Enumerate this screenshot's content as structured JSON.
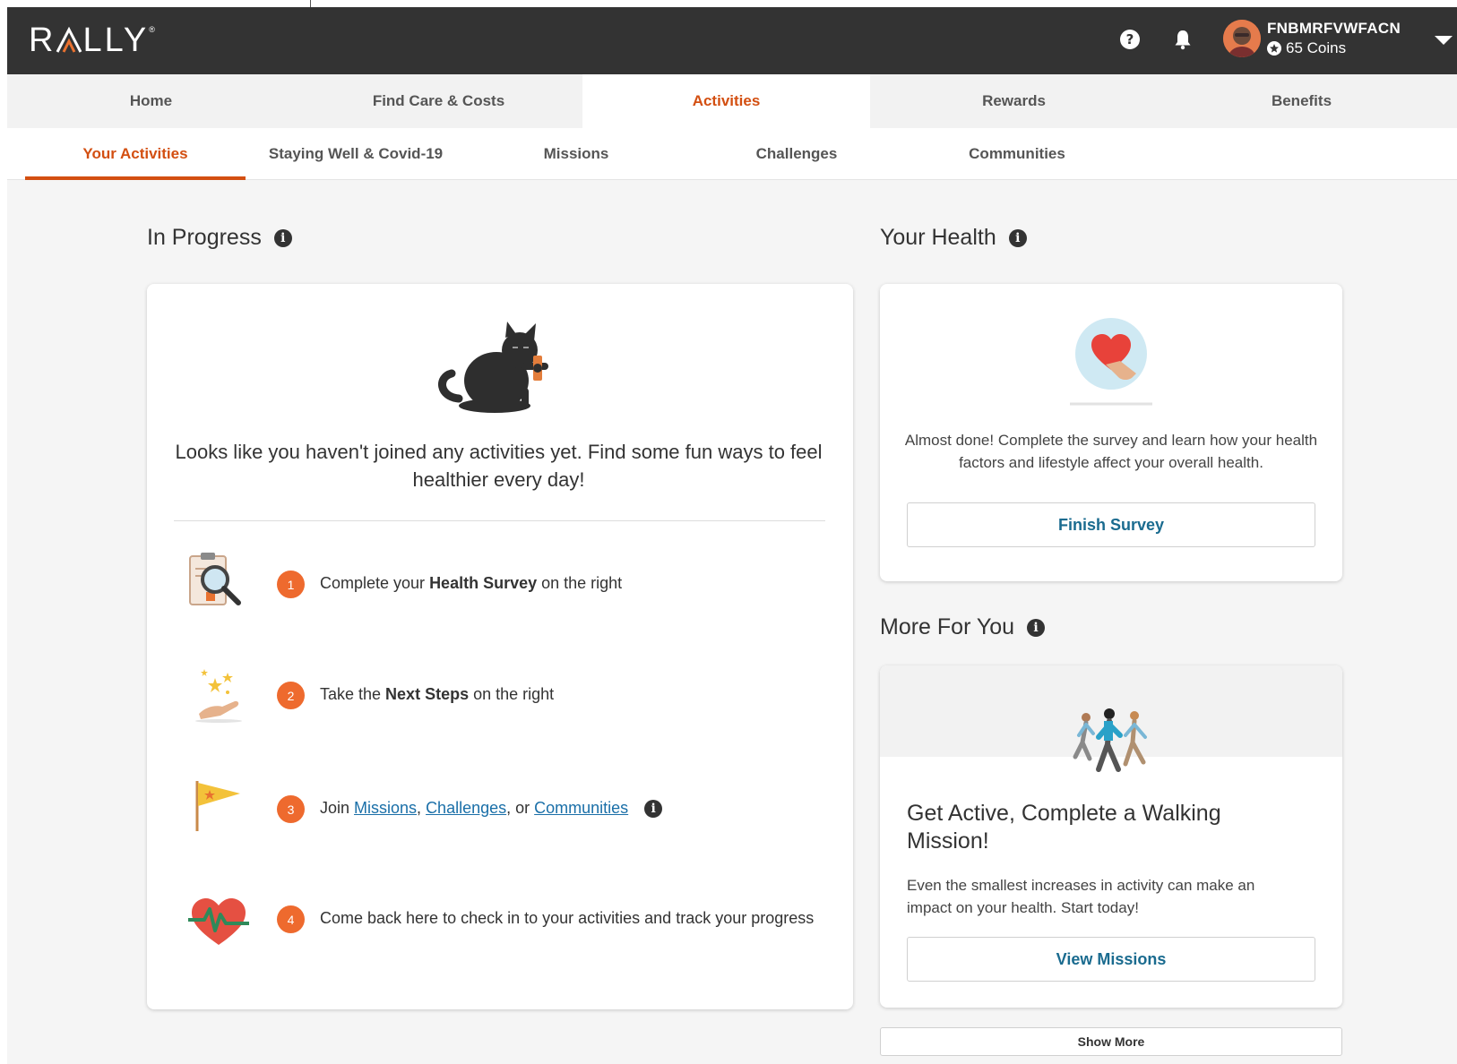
{
  "header": {
    "logo_text": "RALLY",
    "logo_mark": "®",
    "user_name": "FNBMRFVWFACN",
    "coins": "65 Coins",
    "icons": [
      "help-icon",
      "bell-icon",
      "avatar",
      "coin-icon",
      "caret-down-icon"
    ]
  },
  "main_nav": {
    "tabs": [
      {
        "label": "Home"
      },
      {
        "label": "Find Care & Costs"
      },
      {
        "label": "Activities",
        "active": true
      },
      {
        "label": "Rewards"
      },
      {
        "label": "Benefits"
      }
    ]
  },
  "sub_nav": {
    "tabs": [
      {
        "label": "Your Activities",
        "active": true
      },
      {
        "label": "Staying Well & Covid-19"
      },
      {
        "label": "Missions"
      },
      {
        "label": "Challenges"
      },
      {
        "label": "Communities"
      }
    ]
  },
  "in_progress": {
    "title": "In Progress",
    "empty_message": "Looks like you haven't joined any activities yet. Find some fun ways to feel healthier every day!",
    "steps": [
      {
        "number": "1",
        "pre": "Complete your",
        "bold": "Health Survey",
        "post": "on the right",
        "icon": "clipboard-magnifier-icon"
      },
      {
        "number": "2",
        "pre": "Take the",
        "bold": "Next Steps",
        "post": "on the right",
        "icon": "hand-stars-icon"
      },
      {
        "number": "3",
        "pre": "Join",
        "link1": "Missions",
        "sep1": ",",
        "link2": "Challenges",
        "sep2": ", or",
        "link3": "Communities",
        "icon": "flag-icon"
      },
      {
        "number": "4",
        "text": "Come back here to check in to your activities and track your progress",
        "icon": "heartbeat-icon"
      }
    ]
  },
  "your_health": {
    "title": "Your Health",
    "text": "Almost done! Complete the survey and learn how your health factors and lifestyle affect your overall health.",
    "button": "Finish Survey"
  },
  "more_for_you": {
    "title": "More For You",
    "card_title": "Get Active, Complete a Walking Mission!",
    "card_desc": "Even the smallest increases in activity can make an impact on your health. Start today!",
    "button": "View Missions",
    "show_more": "Show More"
  },
  "colors": {
    "accent": "#d34f11",
    "header_bg": "#333333",
    "step_badge": "#ee6a2e",
    "link": "#1a6fa8"
  }
}
